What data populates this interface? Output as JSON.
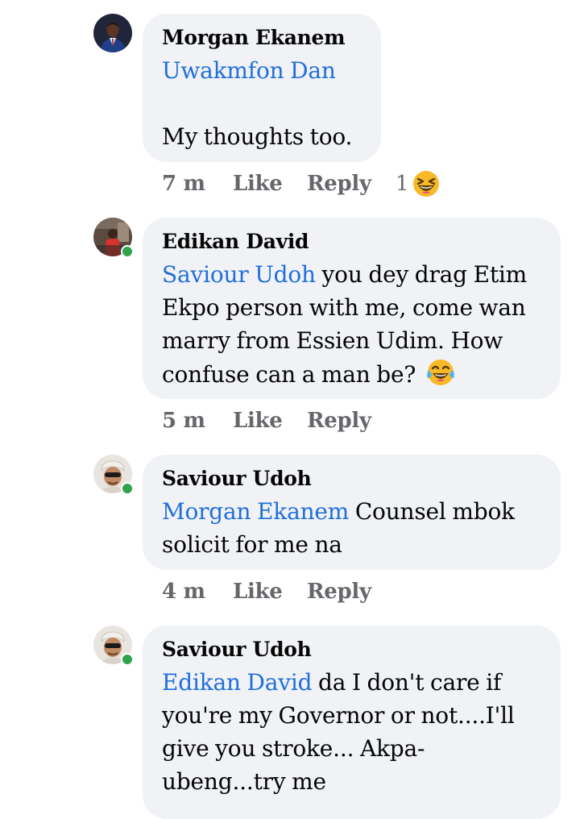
{
  "comments": [
    {
      "author": "Morgan Ekanem",
      "mention": "Uwakmfon Dan",
      "text": "My thoughts too.",
      "time": "7 m",
      "like_label": "Like",
      "reply_label": "Reply",
      "reaction_count": "1",
      "reaction_icon": "laughing-squint-emoji",
      "online": false
    },
    {
      "author": "Edikan David",
      "mention": "Saviour Udoh",
      "text": " you dey drag Etim Ekpo person with me, come wan marry from Essien Udim. How confuse can a man be? ",
      "inline_emoji": "tears-of-joy-emoji",
      "time": "5 m",
      "like_label": "Like",
      "reply_label": "Reply",
      "online": true
    },
    {
      "author": "Saviour Udoh",
      "mention": "Morgan Ekanem",
      "text": " Counsel mbok solicit for me na",
      "time": "4 m",
      "like_label": "Like",
      "reply_label": "Reply",
      "online": true
    },
    {
      "author": "Saviour Udoh",
      "mention": "Edikan David",
      "text": " da I don't care if you're my Governor or not....I'll give you stroke... Akpa-ubeng...try me",
      "online": true
    }
  ],
  "colors": {
    "mention": "#216fdb",
    "bubble": "#f0f2f5",
    "meta": "#65676b",
    "online": "#31a24c"
  }
}
